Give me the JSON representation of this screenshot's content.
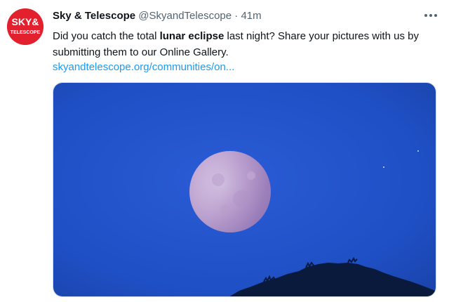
{
  "tweet": {
    "display_name": "Sky & Telescope",
    "handle": "@SkyandTelescope",
    "separator": "·",
    "time": "41m",
    "text_before": "Did you catch the total ",
    "text_bold": "lunar eclipse",
    "text_after": " last night? Share your pictures with us by submitting them to our Online Gallery.",
    "link": "skyandtelescope.org/communities/on...",
    "more_icon": "ellipsis-horizontal-icon",
    "avatar_logo": {
      "line1": "SKY&",
      "line2": "TELESCOPE",
      "color": "#e2202e"
    },
    "media": {
      "description_icon": "photo",
      "sky_color": "#1f4fc4"
    }
  },
  "colors": {
    "text": "#0f1419",
    "muted": "#536471",
    "link": "#1d9bf0"
  }
}
